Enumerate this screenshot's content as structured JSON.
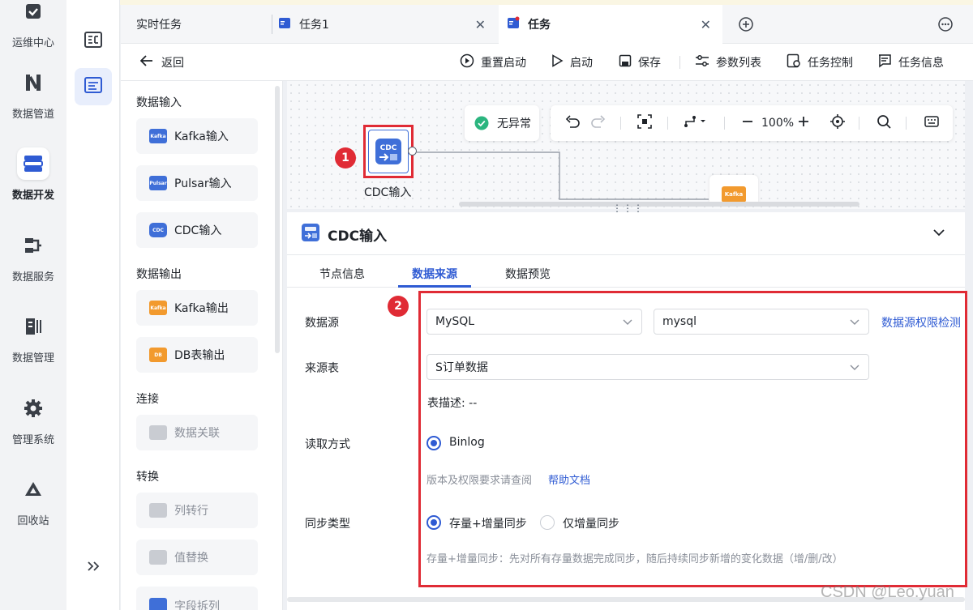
{
  "left_rail": {
    "items": [
      {
        "label": "运维中心",
        "icon": "check-square-icon"
      },
      {
        "label": "数据管道",
        "icon": "pipeline-icon"
      },
      {
        "label": "数据开发",
        "icon": "data-dev-icon",
        "active": true
      },
      {
        "label": "数据服务",
        "icon": "data-service-icon"
      },
      {
        "label": "数据管理",
        "icon": "data-manage-icon"
      },
      {
        "label": "管理系统",
        "icon": "gear-icon"
      },
      {
        "label": "回收站",
        "icon": "recycle-icon"
      }
    ]
  },
  "tabs": [
    {
      "label": "实时任务"
    },
    {
      "label": "任务1",
      "closable": true
    },
    {
      "label": "任务",
      "closable": true,
      "active": true
    }
  ],
  "toolbar": {
    "back": "返回",
    "restart": "重置启动",
    "start": "启动",
    "save": "保存",
    "params": "参数列表",
    "task_control": "任务控制",
    "task_info": "任务信息"
  },
  "node_panel": {
    "sections": [
      {
        "title": "数据输入",
        "items": [
          "Kafka输入",
          "Pulsar输入",
          "CDC输入"
        ]
      },
      {
        "title": "数据输出",
        "items": [
          "Kafka输出",
          "DB表输出"
        ]
      },
      {
        "title": "连接",
        "items": [
          "数据关联"
        ]
      },
      {
        "title": "转换",
        "items": [
          "列转行",
          "值替换",
          "字段拆列"
        ]
      }
    ],
    "icon_texts": {
      "kafka": "Kafka",
      "pulsar": "Pulsar",
      "cdc": "CDC",
      "db": "DB"
    }
  },
  "canvas": {
    "status": "无异常",
    "zoom": "100%",
    "node_label": "CDC输入",
    "node_icon_text": "CDC",
    "kafka_node_text": "Kafka",
    "marker1": "1",
    "marker2": "2"
  },
  "detail": {
    "title": "CDC输入",
    "tabs": [
      "节点信息",
      "数据来源",
      "数据预览"
    ],
    "active_tab": "数据来源",
    "datasource_label": "数据源",
    "datasource_type": "MySQL",
    "datasource_name": "mysql",
    "permission_check": "数据源权限检测",
    "source_table_label": "来源表",
    "source_table": "S订单数据",
    "table_desc": "表描述: --",
    "read_mode_label": "读取方式",
    "read_mode": "Binlog",
    "version_hint": "版本及权限要求请查阅",
    "help_doc": "帮助文档",
    "sync_type_label": "同步类型",
    "sync_options": [
      "存量+增量同步",
      "仅增量同步"
    ],
    "sync_desc": "存量+增量同步：先对所有存量数据完成同步，随后持续同步新增的变化数据（增/删/改）"
  },
  "watermark": "CSDN @Leo.yuan",
  "colors": {
    "accent": "#2f5bd3",
    "highlight": "#e02b35",
    "status_ok": "#2bb57f"
  }
}
